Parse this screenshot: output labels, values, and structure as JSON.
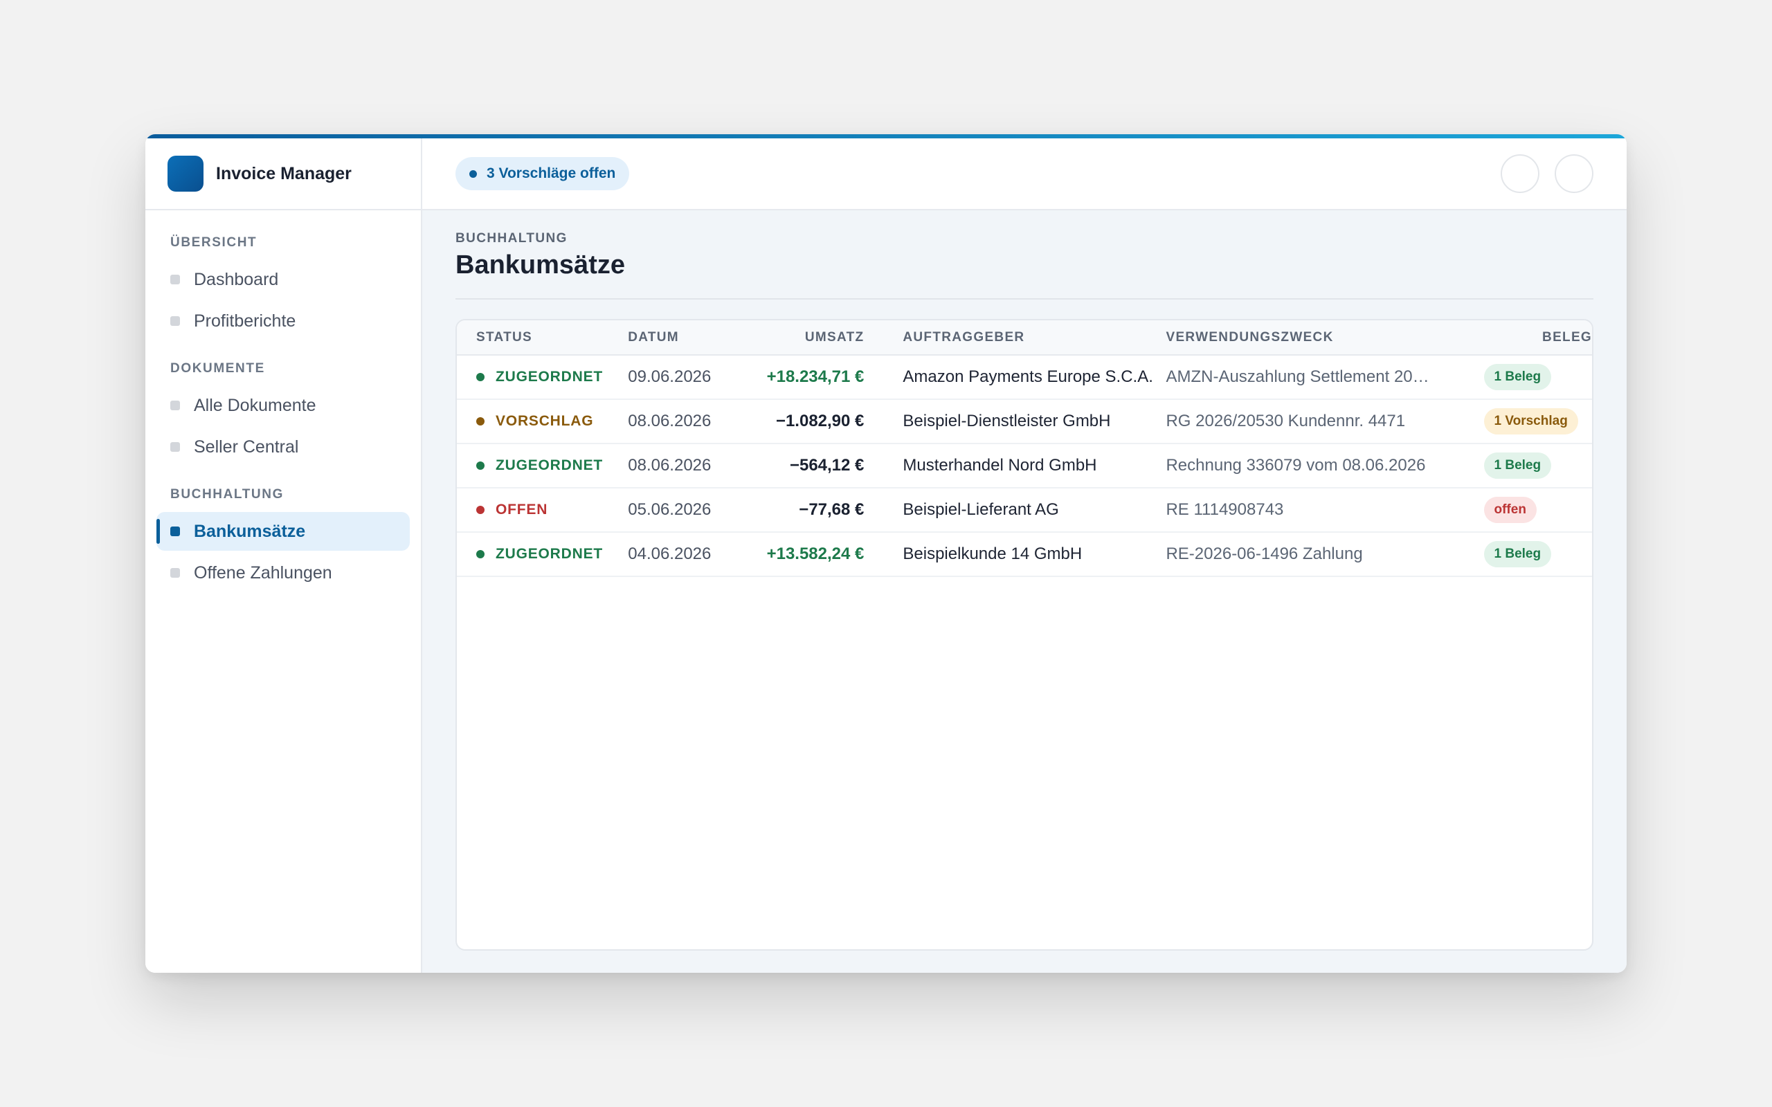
{
  "app": {
    "title": "Invoice Manager"
  },
  "sidebar": {
    "sections": [
      {
        "label": "ÜBERSICHT",
        "items": [
          {
            "label": "Dashboard"
          },
          {
            "label": "Profitberichte"
          }
        ]
      },
      {
        "label": "DOKUMENTE",
        "items": [
          {
            "label": "Alle Dokumente"
          },
          {
            "label": "Seller Central"
          }
        ]
      },
      {
        "label": "BUCHHALTUNG",
        "items": [
          {
            "label": "Bankumsätze",
            "active": true
          },
          {
            "label": "Offene Zahlungen"
          }
        ]
      }
    ]
  },
  "topbar": {
    "pill_label": "3 Vorschläge offen"
  },
  "page": {
    "eyebrow": "BUCHHALTUNG",
    "title": "Bankumsätze"
  },
  "table": {
    "headers": {
      "status": "STATUS",
      "date": "DATUM",
      "amount": "UMSATZ",
      "party": "AUFTRAGGEBER",
      "purpose": "VERWENDUNGSZWECK",
      "beleg": "BELEG"
    },
    "rows": [
      {
        "status": "ZUGEORDNET",
        "date": "09.06.2026",
        "amount": "+18.234,71 €",
        "party": "Amazon Payments Europe S.C.A.",
        "purpose": "AMZN-Auszahlung Settlement 20…",
        "beleg": "1 Beleg"
      },
      {
        "status": "VORSCHLAG",
        "date": "08.06.2026",
        "amount": "−1.082,90 €",
        "party": "Beispiel-Dienstleister GmbH",
        "purpose": "RG 2026/20530 Kundennr. 4471",
        "beleg": "1 Vorschlag"
      },
      {
        "status": "ZUGEORDNET",
        "date": "08.06.2026",
        "amount": "−564,12 €",
        "party": "Musterhandel Nord GmbH",
        "purpose": "Rechnung 336079 vom 08.06.2026",
        "beleg": "1 Beleg"
      },
      {
        "status": "OFFEN",
        "date": "05.06.2026",
        "amount": "−77,68 €",
        "party": "Beispiel-Lieferant AG",
        "purpose": "RE 1114908743",
        "beleg": "offen"
      },
      {
        "status": "ZUGEORDNET",
        "date": "04.06.2026",
        "amount": "+13.582,24 €",
        "party": "Beispielkunde 14 GmbH",
        "purpose": "RE-2026-06-1496 Zahlung",
        "beleg": "1 Beleg"
      }
    ]
  },
  "colors": {
    "accent": "#0b5f9a",
    "status_assigned": "#1d7a4b",
    "status_suggestion": "#8a5a0c",
    "status_open": "#bb3434"
  }
}
